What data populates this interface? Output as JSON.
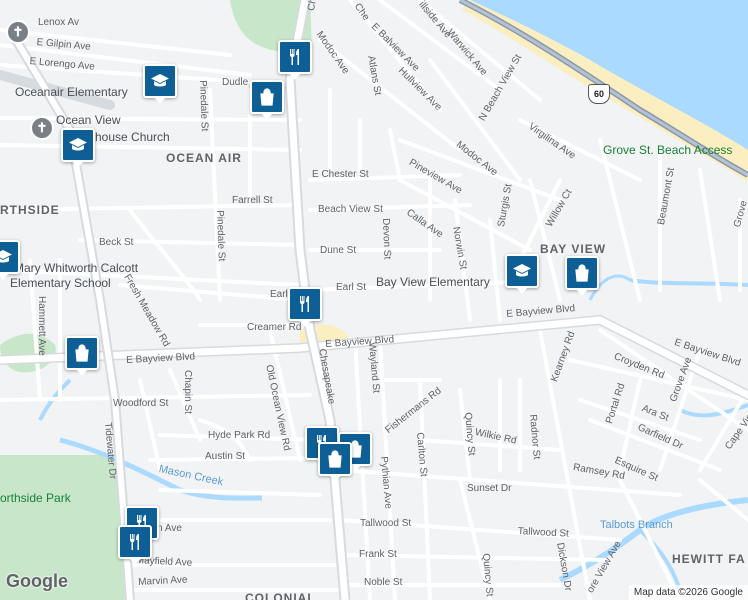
{
  "neighborhoods": {
    "ocean_air": "OCEAN AIR",
    "northside": "RTHSIDE",
    "bay_view": "BAY VIEW",
    "hewitt": "HEWITT FA",
    "colonial": "COLONIAL"
  },
  "places": {
    "oceanair_elementary": "Oceanair Elementary",
    "ocean_view_church_1": "Ocean View",
    "ocean_view_church_2": "house Church",
    "mary_calcott_1": "Mary Whitworth Calcott",
    "mary_calcott_2": "Elementary School",
    "bay_view_elementary": "Bay View Elementary",
    "grove_beach": "Grove St. Beach Access",
    "northside_park": "orthside Park",
    "mason_creek": "Mason Creek",
    "talbots_branch": "Talbots Branch"
  },
  "streets": {
    "lenox": "Lenox Av",
    "gilpin": "E Gilpin Ave",
    "lorengo": "E Lorengo Ave",
    "dudley": "Dudle",
    "pinedale_n": "Pinedale St",
    "pinedale_s": "Pinedale St",
    "farrell": "Farrell St",
    "beck": "Beck St",
    "dune": "Dune St",
    "earl_w": "Earl",
    "earl": "Earl St",
    "creamer": "Creamer Rd",
    "fresh_meadow": "Fresh Meadow Rd",
    "hammett": "Hammett Ave",
    "bayview_w": "E Bayview Blvd",
    "bayview_c": "E Bayview Blvd",
    "bayview_e1": "E Bayview Blvd",
    "bayview_e2": "E Bayview Blvd",
    "woodford": "Woodford St",
    "chapin": "Chapin St",
    "old_ocean_view": "Old Ocean View Rd",
    "hyde_park": "Hyde Park Rd",
    "austin": "Austin St",
    "tidewater": "Tidewater Dr",
    "chesapeake_n": "Ch",
    "chesapeake": "Chesapeake",
    "chester": "E Chester St",
    "beach_view": "Beach View St",
    "devon": "Devon St",
    "wayland": "Wayland St",
    "pythian": "Pythian Ave",
    "carlton": "Carlton St",
    "fishermans": "Fishermans Rd",
    "quincy_n": "Quincy St",
    "quincy_s": "Quincy St",
    "wilkie": "Wilkie Rd",
    "radnor": "Radnor St",
    "ramsey": "Ramsey Rd",
    "sunset": "Sunset Dr",
    "tallwood_w": "Tallwood St",
    "tallwood_e": "Tallwood St",
    "frank": "Frank St",
    "noble": "Noble St",
    "mayfield": "Mayfield Ave",
    "marvin": "Marvin Ave",
    "uan": "uan Ave",
    "dickson": "Dickson Dr",
    "shore_view": "ore View Ave",
    "modoc_w": "Modoc Ave",
    "modoc_e": "Modoc Ave",
    "atlans": "Atlans St",
    "che_n": "Che",
    "balview": "E Balview Ave",
    "hillside": "illside Ave",
    "warwick": "Warwick Ave",
    "hullview": "Hullview Ave",
    "n_beach_view": "N Beach View St",
    "virgilina": "Virgilina Ave",
    "pineview": "Pineview Ave",
    "calla": "Calla Ave",
    "norwin": "Norwin St",
    "sturgis": "Sturgis St",
    "willow": "Willow Ct",
    "beaumont": "Beaumont St",
    "grove_e": "Grove",
    "grove_ave": "Grove Ave",
    "kearney": "Kearney Rd",
    "croyden": "Croyden Rd",
    "portal": "Portal Rd",
    "ara": "Ara St",
    "garfield": "Garfield Dr",
    "esquire": "Esquire St",
    "cape_view": "Cape Vie"
  },
  "route_shield": "60",
  "footer": {
    "logo": "Google",
    "attribution": "Map data ©2026 Google"
  },
  "colors": {
    "land": "#f1f3f4",
    "water": "#aadaff",
    "park": "#c8e6c9",
    "beach": "#fbeec1",
    "major_road": "#d6dbe0",
    "marker": "#0d5f95"
  }
}
